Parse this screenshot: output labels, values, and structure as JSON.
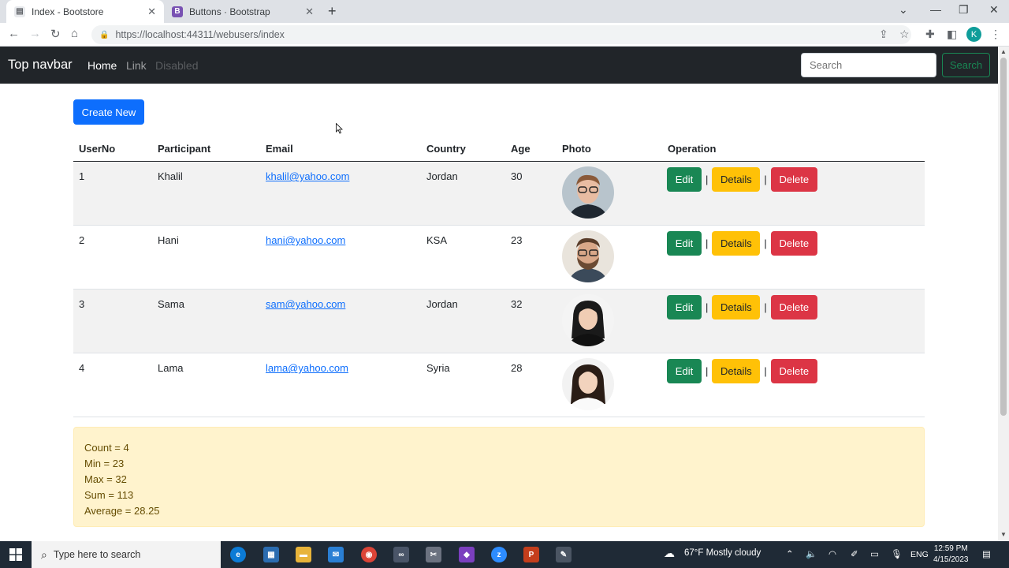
{
  "browser": {
    "tabs": [
      {
        "title": "Index - Bootstore",
        "active": true
      },
      {
        "title": "Buttons · Bootstrap",
        "active": false
      }
    ],
    "url": "https://localhost:44311/webusers/index",
    "profile_initial": "K"
  },
  "navbar": {
    "brand": "Top navbar",
    "links": [
      "Home",
      "Link",
      "Disabled"
    ],
    "search_placeholder": "Search",
    "search_button": "Search"
  },
  "create_button": "Create New",
  "table": {
    "headers": [
      "UserNo",
      "Participant",
      "Email",
      "Country",
      "Age",
      "Photo",
      "Operation"
    ],
    "rows": [
      {
        "no": "1",
        "name": "Khalil",
        "email": "khalil@yahoo.com",
        "country": "Jordan",
        "age": "30"
      },
      {
        "no": "2",
        "name": "Hani",
        "email": "hani@yahoo.com",
        "country": "KSA",
        "age": "23"
      },
      {
        "no": "3",
        "name": "Sama",
        "email": "sam@yahoo.com",
        "country": "Jordan",
        "age": "32"
      },
      {
        "no": "4",
        "name": "Lama",
        "email": "lama@yahoo.com",
        "country": "Syria",
        "age": "28"
      }
    ],
    "ops": {
      "edit": "Edit",
      "details": "Details",
      "delete": "Delete",
      "separator": "|"
    }
  },
  "stats": {
    "count": "Count = 4",
    "min": "Min = 23",
    "max": "Max = 32",
    "sum": "Sum = 113",
    "average": "Average = 28.25"
  },
  "taskbar": {
    "search_placeholder": "Type here to search",
    "weather": "67°F  Mostly cloudy",
    "language": "ENG",
    "time": "12:59 PM",
    "date": "4/15/2023"
  },
  "colors": {
    "primary": "#0d6efd",
    "success": "#198754",
    "warning": "#ffc107",
    "danger": "#dc3545",
    "navbar_bg": "#212529",
    "alert_bg": "#fff3cd"
  }
}
